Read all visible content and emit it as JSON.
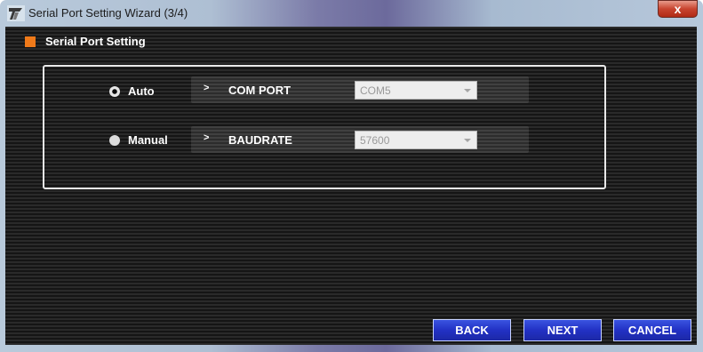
{
  "window": {
    "title": "Serial Port Setting Wizard (3/4)",
    "close_label": "x"
  },
  "header": {
    "label": "Serial Port Setting",
    "accent": "#f07a1a"
  },
  "mode": {
    "auto_label": "Auto",
    "manual_label": "Manual",
    "selected": "Auto"
  },
  "com_port": {
    "label": "COM PORT",
    "value": "COM5"
  },
  "baudrate": {
    "label": "BAUDRATE",
    "value": "57600"
  },
  "bar_arrow": ">",
  "buttons": {
    "back": "BACK",
    "next": "NEXT",
    "cancel": "CANCEL"
  },
  "colors": {
    "button_blue": "#2231c4",
    "close_red": "#c8442f"
  }
}
